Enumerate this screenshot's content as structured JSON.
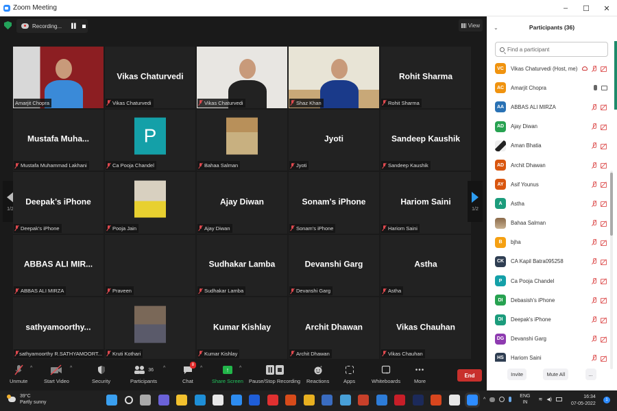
{
  "window": {
    "title": "Zoom Meeting",
    "controls": [
      "–",
      "☐",
      "✕"
    ]
  },
  "topbar": {
    "recording_label": "Recording...",
    "view_label": "View"
  },
  "gallery": {
    "page_indicator_left": "1/2",
    "page_indicator_right": "1/2",
    "tiles": [
      {
        "big": "",
        "tag": "Amarjit Chopra",
        "muted": false,
        "video": "person-blue",
        "speaker": true
      },
      {
        "big": "Vikas Chaturvedi",
        "tag": "Vikas Chaturvedi",
        "muted": true,
        "video": ""
      },
      {
        "big": "",
        "tag": "Vikas Chaturvedi",
        "muted": true,
        "video": "person-white"
      },
      {
        "big": "",
        "tag": "Shaz Khan",
        "muted": true,
        "video": "person-suit"
      },
      {
        "big": "Rohit Sharma",
        "tag": "Rohit Sharma",
        "muted": true,
        "video": ""
      },
      {
        "big": "Mustafa  Muha...",
        "tag": "Mustafa Muhammad Lakhani",
        "muted": true,
        "video": ""
      },
      {
        "big": "",
        "tag": "Ca Pooja Chandel",
        "muted": true,
        "video": "avatar-p",
        "avatar_letter": "P"
      },
      {
        "big": "",
        "tag": "Bahaa Salman",
        "muted": true,
        "video": "photo-bahaa"
      },
      {
        "big": "Jyoti",
        "tag": "Jyoti",
        "muted": true,
        "video": ""
      },
      {
        "big": "Sandeep Kaushik",
        "tag": "Sandeep Kaushik",
        "muted": true,
        "video": ""
      },
      {
        "big": "Deepak’s iPhone",
        "tag": "Deepak’s iPhone",
        "muted": true,
        "video": ""
      },
      {
        "big": "",
        "tag": "Pooja Jain",
        "muted": true,
        "video": "photo-pooja"
      },
      {
        "big": "Ajay Diwan",
        "tag": "Ajay Diwan",
        "muted": true,
        "video": ""
      },
      {
        "big": "Sonam’s iPhone",
        "tag": "Sonam’s iPhone",
        "muted": true,
        "video": ""
      },
      {
        "big": "Hariom Saini",
        "tag": "Hariom Saini",
        "muted": true,
        "video": ""
      },
      {
        "big": "ABBAS ALI MIR...",
        "tag": "ABBAS ALI MIRZA",
        "muted": true,
        "video": ""
      },
      {
        "big": "",
        "tag": "Praveen",
        "muted": true,
        "video": ""
      },
      {
        "big": "Sudhakar Lamba",
        "tag": "Sudhakar Lamba",
        "muted": true,
        "video": ""
      },
      {
        "big": "Devanshi Garg",
        "tag": "Devanshi Garg",
        "muted": true,
        "video": ""
      },
      {
        "big": "Astha",
        "tag": "Astha",
        "muted": true,
        "video": ""
      },
      {
        "big": "sathyamoorthy...",
        "tag": "sathyamoorthy R.SATHYAMOORT...",
        "muted": true,
        "video": ""
      },
      {
        "big": "",
        "tag": "Kruti Kothari",
        "muted": true,
        "video": "photo-kruti"
      },
      {
        "big": "Kumar Kishlay",
        "tag": "Kumar Kishlay",
        "muted": true,
        "video": ""
      },
      {
        "big": "Archit Dhawan",
        "tag": "Archit Dhawan",
        "muted": true,
        "video": ""
      },
      {
        "big": "Vikas Chauhan",
        "tag": "Vikas Chauhan",
        "muted": true,
        "video": ""
      }
    ]
  },
  "toolbar": {
    "unmute": "Unmute",
    "start_video": "Start Video",
    "security": "Security",
    "participants": "Participants",
    "participants_count": "36",
    "chat": "Chat",
    "chat_badge": "8",
    "share_screen": "Share Screen",
    "pause_stop_recording": "Pause/Stop Recording",
    "reactions": "Reactions",
    "apps": "Apps",
    "whiteboards": "Whiteboards",
    "more": "More",
    "end": "End"
  },
  "participants_panel": {
    "title": "Participants (36)",
    "search_placeholder": "Find a participant",
    "participants": [
      {
        "initials": "VC",
        "name": "Vikas Chaturvedi (Host, me)",
        "color": "#f0930f",
        "status": "host"
      },
      {
        "initials": "AC",
        "name": "Amarjit Chopra",
        "color": "#f0930f",
        "status": "live"
      },
      {
        "initials": "AA",
        "name": "ABBAS ALI MIRZA",
        "color": "#2a72b5",
        "status": "off"
      },
      {
        "initials": "AD",
        "name": "Ajay Diwan",
        "color": "#27a251",
        "status": "off"
      },
      {
        "initials": "",
        "name": "Aman Bhatia",
        "color": "#dddddd",
        "status": "off",
        "photo": true
      },
      {
        "initials": "AD",
        "name": "Archit Dhawan",
        "color": "#d9560f",
        "status": "off"
      },
      {
        "initials": "AY",
        "name": "Asif Younus",
        "color": "#d9560f",
        "status": "off"
      },
      {
        "initials": "A",
        "name": "Astha",
        "color": "#1c9c7c",
        "status": "off"
      },
      {
        "initials": "",
        "name": "Bahaa Salman",
        "color": "#a38a6a",
        "status": "off",
        "photo": true
      },
      {
        "initials": "B",
        "name": "bjha",
        "color": "#f5a012",
        "status": "off"
      },
      {
        "initials": "CK",
        "name": "CA Kapil Batra095258",
        "color": "#2f3e52",
        "status": "off"
      },
      {
        "initials": "P",
        "name": "Ca Pooja Chandel",
        "color": "#14a0a8",
        "status": "off"
      },
      {
        "initials": "DI",
        "name": "Debasish's iPhone",
        "color": "#27a251",
        "status": "off"
      },
      {
        "initials": "DI",
        "name": "Deepak's iPhone",
        "color": "#1c9c7c",
        "status": "off"
      },
      {
        "initials": "DG",
        "name": "Devanshi Garg",
        "color": "#8e3bb0",
        "status": "off"
      },
      {
        "initials": "HS",
        "name": "Hariom Saini",
        "color": "#2f3e52",
        "status": "off"
      }
    ],
    "footer": {
      "invite": "Invite",
      "mute_all": "Mute All",
      "more": "..."
    }
  },
  "taskbar": {
    "weather_temp": "39°C",
    "weather_desc": "Partly sunny",
    "apps": [
      "windows-start",
      "search",
      "task-view",
      "teams-chat",
      "file-explorer",
      "edge",
      "store",
      "mail",
      "dropbox",
      "anydesk",
      "office",
      "chrome",
      "remote-desktop",
      "control-panel",
      "winrar",
      "media-player",
      "mcafee",
      "photoshop",
      "powerpoint",
      "acrobat",
      "zoom"
    ],
    "app_colors": [
      "#3aa0f0",
      "#dddddd",
      "#aaaaaa",
      "#6b62d8",
      "#f2c12e",
      "#1e8fd8",
      "#e8e8e8",
      "#2d8cf0",
      "#1f5ed8",
      "#e03030",
      "#d84b1a",
      "#e8b020",
      "#3a6cc0",
      "#48a0d8",
      "#c8402a",
      "#2d7cd8",
      "#c81e28",
      "#1c2a5a",
      "#d8461e",
      "#e8e8e8",
      "#2d8cff"
    ],
    "lang": "ENG",
    "region": "IN",
    "time": "16:34",
    "date": "07-05-2022",
    "notification_count": "1"
  }
}
